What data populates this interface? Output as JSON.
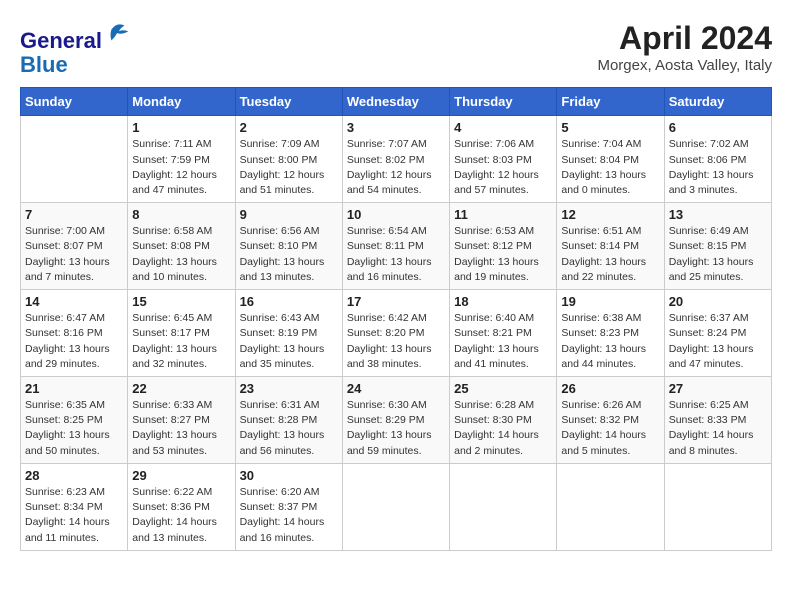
{
  "header": {
    "logo_line1": "General",
    "logo_line2": "Blue",
    "title": "April 2024",
    "subtitle": "Morgex, Aosta Valley, Italy"
  },
  "weekdays": [
    "Sunday",
    "Monday",
    "Tuesday",
    "Wednesday",
    "Thursday",
    "Friday",
    "Saturday"
  ],
  "weeks": [
    [
      {
        "day": "",
        "sunrise": "",
        "sunset": "",
        "daylight": ""
      },
      {
        "day": "1",
        "sunrise": "Sunrise: 7:11 AM",
        "sunset": "Sunset: 7:59 PM",
        "daylight": "Daylight: 12 hours and 47 minutes."
      },
      {
        "day": "2",
        "sunrise": "Sunrise: 7:09 AM",
        "sunset": "Sunset: 8:00 PM",
        "daylight": "Daylight: 12 hours and 51 minutes."
      },
      {
        "day": "3",
        "sunrise": "Sunrise: 7:07 AM",
        "sunset": "Sunset: 8:02 PM",
        "daylight": "Daylight: 12 hours and 54 minutes."
      },
      {
        "day": "4",
        "sunrise": "Sunrise: 7:06 AM",
        "sunset": "Sunset: 8:03 PM",
        "daylight": "Daylight: 12 hours and 57 minutes."
      },
      {
        "day": "5",
        "sunrise": "Sunrise: 7:04 AM",
        "sunset": "Sunset: 8:04 PM",
        "daylight": "Daylight: 13 hours and 0 minutes."
      },
      {
        "day": "6",
        "sunrise": "Sunrise: 7:02 AM",
        "sunset": "Sunset: 8:06 PM",
        "daylight": "Daylight: 13 hours and 3 minutes."
      }
    ],
    [
      {
        "day": "7",
        "sunrise": "Sunrise: 7:00 AM",
        "sunset": "Sunset: 8:07 PM",
        "daylight": "Daylight: 13 hours and 7 minutes."
      },
      {
        "day": "8",
        "sunrise": "Sunrise: 6:58 AM",
        "sunset": "Sunset: 8:08 PM",
        "daylight": "Daylight: 13 hours and 10 minutes."
      },
      {
        "day": "9",
        "sunrise": "Sunrise: 6:56 AM",
        "sunset": "Sunset: 8:10 PM",
        "daylight": "Daylight: 13 hours and 13 minutes."
      },
      {
        "day": "10",
        "sunrise": "Sunrise: 6:54 AM",
        "sunset": "Sunset: 8:11 PM",
        "daylight": "Daylight: 13 hours and 16 minutes."
      },
      {
        "day": "11",
        "sunrise": "Sunrise: 6:53 AM",
        "sunset": "Sunset: 8:12 PM",
        "daylight": "Daylight: 13 hours and 19 minutes."
      },
      {
        "day": "12",
        "sunrise": "Sunrise: 6:51 AM",
        "sunset": "Sunset: 8:14 PM",
        "daylight": "Daylight: 13 hours and 22 minutes."
      },
      {
        "day": "13",
        "sunrise": "Sunrise: 6:49 AM",
        "sunset": "Sunset: 8:15 PM",
        "daylight": "Daylight: 13 hours and 25 minutes."
      }
    ],
    [
      {
        "day": "14",
        "sunrise": "Sunrise: 6:47 AM",
        "sunset": "Sunset: 8:16 PM",
        "daylight": "Daylight: 13 hours and 29 minutes."
      },
      {
        "day": "15",
        "sunrise": "Sunrise: 6:45 AM",
        "sunset": "Sunset: 8:17 PM",
        "daylight": "Daylight: 13 hours and 32 minutes."
      },
      {
        "day": "16",
        "sunrise": "Sunrise: 6:43 AM",
        "sunset": "Sunset: 8:19 PM",
        "daylight": "Daylight: 13 hours and 35 minutes."
      },
      {
        "day": "17",
        "sunrise": "Sunrise: 6:42 AM",
        "sunset": "Sunset: 8:20 PM",
        "daylight": "Daylight: 13 hours and 38 minutes."
      },
      {
        "day": "18",
        "sunrise": "Sunrise: 6:40 AM",
        "sunset": "Sunset: 8:21 PM",
        "daylight": "Daylight: 13 hours and 41 minutes."
      },
      {
        "day": "19",
        "sunrise": "Sunrise: 6:38 AM",
        "sunset": "Sunset: 8:23 PM",
        "daylight": "Daylight: 13 hours and 44 minutes."
      },
      {
        "day": "20",
        "sunrise": "Sunrise: 6:37 AM",
        "sunset": "Sunset: 8:24 PM",
        "daylight": "Daylight: 13 hours and 47 minutes."
      }
    ],
    [
      {
        "day": "21",
        "sunrise": "Sunrise: 6:35 AM",
        "sunset": "Sunset: 8:25 PM",
        "daylight": "Daylight: 13 hours and 50 minutes."
      },
      {
        "day": "22",
        "sunrise": "Sunrise: 6:33 AM",
        "sunset": "Sunset: 8:27 PM",
        "daylight": "Daylight: 13 hours and 53 minutes."
      },
      {
        "day": "23",
        "sunrise": "Sunrise: 6:31 AM",
        "sunset": "Sunset: 8:28 PM",
        "daylight": "Daylight: 13 hours and 56 minutes."
      },
      {
        "day": "24",
        "sunrise": "Sunrise: 6:30 AM",
        "sunset": "Sunset: 8:29 PM",
        "daylight": "Daylight: 13 hours and 59 minutes."
      },
      {
        "day": "25",
        "sunrise": "Sunrise: 6:28 AM",
        "sunset": "Sunset: 8:30 PM",
        "daylight": "Daylight: 14 hours and 2 minutes."
      },
      {
        "day": "26",
        "sunrise": "Sunrise: 6:26 AM",
        "sunset": "Sunset: 8:32 PM",
        "daylight": "Daylight: 14 hours and 5 minutes."
      },
      {
        "day": "27",
        "sunrise": "Sunrise: 6:25 AM",
        "sunset": "Sunset: 8:33 PM",
        "daylight": "Daylight: 14 hours and 8 minutes."
      }
    ],
    [
      {
        "day": "28",
        "sunrise": "Sunrise: 6:23 AM",
        "sunset": "Sunset: 8:34 PM",
        "daylight": "Daylight: 14 hours and 11 minutes."
      },
      {
        "day": "29",
        "sunrise": "Sunrise: 6:22 AM",
        "sunset": "Sunset: 8:36 PM",
        "daylight": "Daylight: 14 hours and 13 minutes."
      },
      {
        "day": "30",
        "sunrise": "Sunrise: 6:20 AM",
        "sunset": "Sunset: 8:37 PM",
        "daylight": "Daylight: 14 hours and 16 minutes."
      },
      {
        "day": "",
        "sunrise": "",
        "sunset": "",
        "daylight": ""
      },
      {
        "day": "",
        "sunrise": "",
        "sunset": "",
        "daylight": ""
      },
      {
        "day": "",
        "sunrise": "",
        "sunset": "",
        "daylight": ""
      },
      {
        "day": "",
        "sunrise": "",
        "sunset": "",
        "daylight": ""
      }
    ]
  ]
}
